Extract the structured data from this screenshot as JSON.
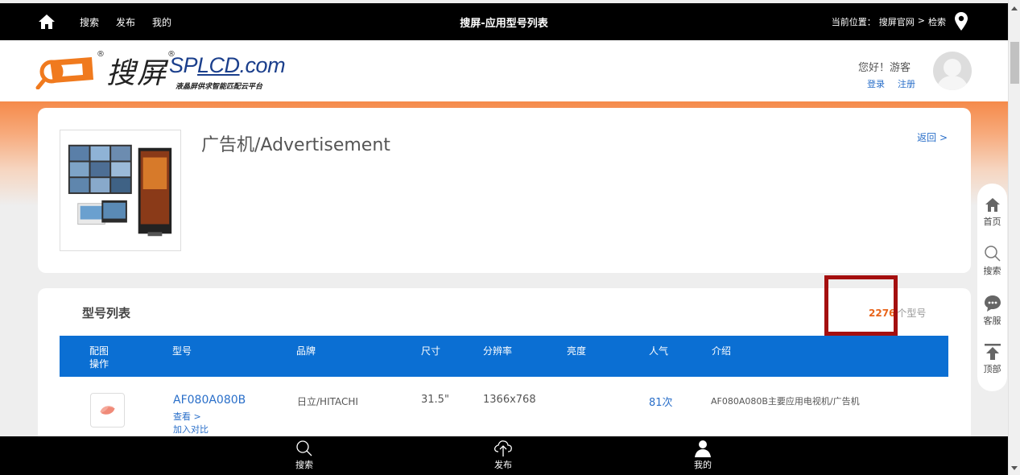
{
  "topbar": {
    "nav": [
      "搜索",
      "发布",
      "我的"
    ],
    "title": "搜屏-应用型号列表",
    "location_prefix": "当前位置：",
    "location_site": "搜屏官网",
    "location_sep": ">",
    "location_current": "检索"
  },
  "header": {
    "logo_cn": "搜屏",
    "logo_reg": "®",
    "logo_en_pre": "SP",
    "logo_en_lcd": "LCD",
    "logo_en_post": ".com",
    "logo_sub": "液晶屏供求智能匹配云平台",
    "greeting": "您好！游客",
    "login": "登录",
    "register": "注册"
  },
  "category": {
    "title": "广告机/Advertisement",
    "back": "返回 >"
  },
  "model_list": {
    "title": "型号列表",
    "count": "2276",
    "count_unit": "个型号",
    "headers": [
      "配图",
      "操作",
      "型号",
      "品牌",
      "尺寸",
      "分辨率",
      "亮度",
      "人气",
      "介绍"
    ],
    "rows": [
      {
        "model": "AF080A080B",
        "view": "查看 >",
        "compare": "加入对比",
        "brand": "日立/HITACHI",
        "size": "31.5\"",
        "resolution": "1366x768",
        "brightness": "",
        "popularity": "81次",
        "intro": "AF080A080B主要应用电视机/广告机"
      }
    ]
  },
  "sidebar": {
    "items": [
      "首页",
      "搜索",
      "客服",
      "顶部"
    ]
  },
  "bottombar": {
    "items": [
      "搜索",
      "发布",
      "我的"
    ]
  },
  "colors": {
    "accent_blue": "#0b6fd3",
    "link_blue": "#2a6fc9",
    "count_orange": "#e8641a",
    "highlight_red": "#a40f0f"
  }
}
